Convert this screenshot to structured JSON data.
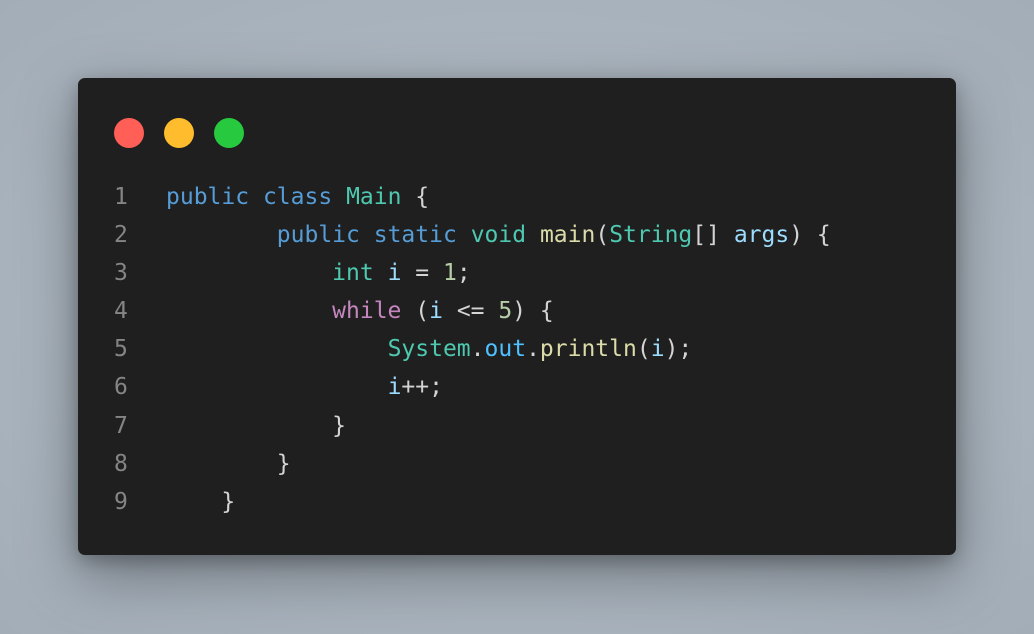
{
  "window": {
    "dots": [
      {
        "name": "close",
        "color": "#ff5f56"
      },
      {
        "name": "minimize",
        "color": "#ffbd2e"
      },
      {
        "name": "maximize",
        "color": "#27c93f"
      }
    ]
  },
  "code": {
    "lines": [
      {
        "num": "1",
        "indent": "",
        "tokens": [
          {
            "t": "public",
            "c": "kw-blue"
          },
          {
            "t": " ",
            "c": "punc"
          },
          {
            "t": "class",
            "c": "kw-blue"
          },
          {
            "t": " ",
            "c": "punc"
          },
          {
            "t": "Main",
            "c": "type"
          },
          {
            "t": " {",
            "c": "punc"
          }
        ]
      },
      {
        "num": "2",
        "indent": "        ",
        "tokens": [
          {
            "t": "public",
            "c": "kw-blue"
          },
          {
            "t": " ",
            "c": "punc"
          },
          {
            "t": "static",
            "c": "kw-blue"
          },
          {
            "t": " ",
            "c": "punc"
          },
          {
            "t": "void",
            "c": "type"
          },
          {
            "t": " ",
            "c": "punc"
          },
          {
            "t": "main",
            "c": "fn"
          },
          {
            "t": "(",
            "c": "punc"
          },
          {
            "t": "String",
            "c": "type"
          },
          {
            "t": "[] ",
            "c": "punc"
          },
          {
            "t": "args",
            "c": "var"
          },
          {
            "t": ") {",
            "c": "punc"
          }
        ]
      },
      {
        "num": "3",
        "indent": "            ",
        "tokens": [
          {
            "t": "int",
            "c": "type"
          },
          {
            "t": " ",
            "c": "punc"
          },
          {
            "t": "i",
            "c": "var"
          },
          {
            "t": " = ",
            "c": "punc"
          },
          {
            "t": "1",
            "c": "num"
          },
          {
            "t": ";",
            "c": "punc"
          }
        ]
      },
      {
        "num": "4",
        "indent": "            ",
        "tokens": [
          {
            "t": "while",
            "c": "kw-purple"
          },
          {
            "t": " (",
            "c": "punc"
          },
          {
            "t": "i",
            "c": "var"
          },
          {
            "t": " <= ",
            "c": "punc"
          },
          {
            "t": "5",
            "c": "num"
          },
          {
            "t": ") {",
            "c": "punc"
          }
        ]
      },
      {
        "num": "5",
        "indent": "                ",
        "tokens": [
          {
            "t": "System",
            "c": "type"
          },
          {
            "t": ".",
            "c": "punc"
          },
          {
            "t": "out",
            "c": "prop"
          },
          {
            "t": ".",
            "c": "punc"
          },
          {
            "t": "println",
            "c": "fn"
          },
          {
            "t": "(",
            "c": "punc"
          },
          {
            "t": "i",
            "c": "var"
          },
          {
            "t": ");",
            "c": "punc"
          }
        ]
      },
      {
        "num": "6",
        "indent": "                ",
        "tokens": [
          {
            "t": "i",
            "c": "var"
          },
          {
            "t": "++;",
            "c": "punc"
          }
        ]
      },
      {
        "num": "7",
        "indent": "            ",
        "tokens": [
          {
            "t": "}",
            "c": "punc"
          }
        ]
      },
      {
        "num": "8",
        "indent": "        ",
        "tokens": [
          {
            "t": "}",
            "c": "punc"
          }
        ]
      },
      {
        "num": "9",
        "indent": "    ",
        "tokens": [
          {
            "t": "}",
            "c": "punc"
          }
        ]
      }
    ]
  }
}
